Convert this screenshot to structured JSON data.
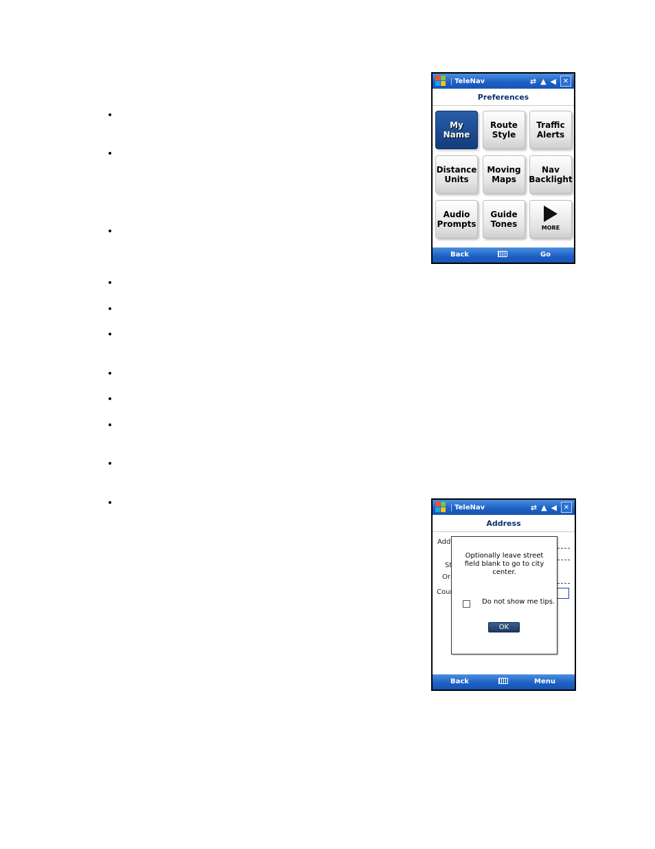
{
  "preferences_screen": {
    "app_name": "TeleNav",
    "title": "Preferences",
    "tiles": [
      "My Name",
      "Route\nStyle",
      "Traffic\nAlerts",
      "Distance\nUnits",
      "Moving\nMaps",
      "Nav\nBacklight",
      "Audio\nPrompts",
      "Guide\nTones"
    ],
    "more_label": "MORE",
    "soft_left": "Back",
    "soft_right": "Go"
  },
  "address_screen": {
    "app_name": "TeleNav",
    "title": "Address",
    "field_fragments": [
      "Add",
      "St",
      "Or",
      "Coun"
    ],
    "dialog": {
      "message": "Optionally leave street field blank to go to city center.",
      "checkbox_label": "Do not show me tips.",
      "ok_label": "OK"
    },
    "soft_left": "Back",
    "soft_right": "Menu"
  }
}
